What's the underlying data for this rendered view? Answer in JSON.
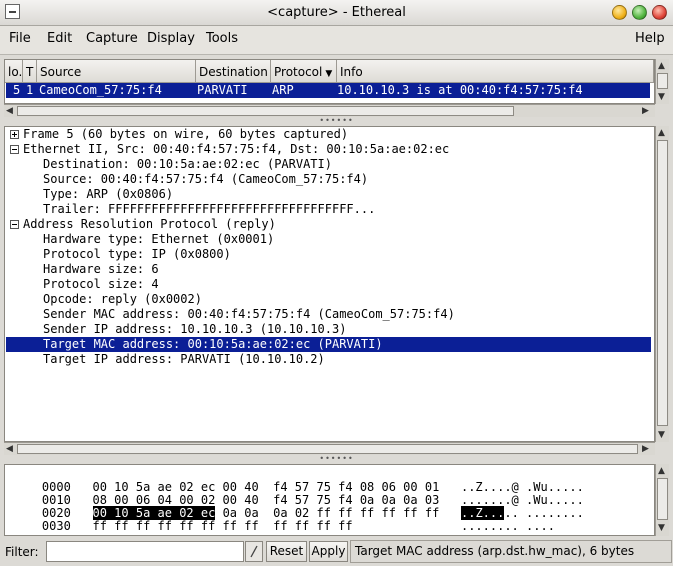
{
  "window": {
    "title": "<capture> - Ethereal"
  },
  "menubar": {
    "file": "File",
    "edit": "Edit",
    "capture": "Capture",
    "display": "Display",
    "tools": "Tools",
    "help": "Help"
  },
  "packet_list": {
    "columns": [
      "lo.",
      "T",
      "Source",
      "Destination",
      "Protocol",
      "Info"
    ],
    "rows": [
      {
        "no": "5",
        "time": "1",
        "source": "CameoCom_57:75:f4",
        "destination": "PARVATI",
        "protocol": "ARP",
        "info": "10.10.10.3 is at 00:40:f4:57:75:f4"
      }
    ]
  },
  "detail_tree": {
    "lines": [
      "Frame 5 (60 bytes on wire, 60 bytes captured)",
      "Ethernet II, Src: 00:40:f4:57:75:f4, Dst: 00:10:5a:ae:02:ec",
      "Destination: 00:10:5a:ae:02:ec (PARVATI)",
      "Source: 00:40:f4:57:75:f4 (CameoCom_57:75:f4)",
      "Type: ARP (0x0806)",
      "Trailer: FFFFFFFFFFFFFFFFFFFFFFFFFFFFFFFFFF...",
      "Address Resolution Protocol (reply)",
      "Hardware type: Ethernet (0x0001)",
      "Protocol type: IP (0x0800)",
      "Hardware size: 6",
      "Protocol size: 4",
      "Opcode: reply (0x0002)",
      "Sender MAC address: 00:40:f4:57:75:f4 (CameoCom_57:75:f4)",
      "Sender IP address: 10.10.10.3 (10.10.10.3)",
      "Target MAC address: 00:10:5a:ae:02:ec (PARVATI)",
      "Target IP address: PARVATI (10.10.10.2)"
    ],
    "selected_index": 14
  },
  "hex_dump": {
    "rows": [
      {
        "offset": "0000",
        "hex_a": "00 10 5a ae 02 ec 00 40",
        "hex_b": "f4 57 75 f4 08 06 00 01",
        "ascii_a": "..Z....@",
        "ascii_b": ".Wu....."
      },
      {
        "offset": "0010",
        "hex_a": "08 00 06 04 00 02 00 40",
        "hex_b": "f4 57 75 f4 0a 0a 0a 03",
        "ascii_a": ".......@",
        "ascii_b": ".Wu....."
      },
      {
        "offset": "0020",
        "hex_sel": "00 10 5a ae 02 ec",
        "hex_a_rest": "0a 0a",
        "hex_b": "0a 02 ff ff ff ff ff ff",
        "ascii_sel": "..Z...",
        "ascii_a_rest": "..",
        "ascii_b": "........"
      },
      {
        "offset": "0030",
        "hex_a": "ff ff ff ff ff ff ff ff",
        "hex_b": "ff ff ff ff",
        "ascii_a": "........",
        "ascii_b": "...."
      }
    ]
  },
  "statusbar": {
    "filter_label": "Filter:",
    "filter_value": "",
    "reset": "Reset",
    "apply": "Apply",
    "status_text": "Target MAC address (arp.dst.hw_mac), 6 bytes"
  },
  "colors": {
    "selection": "#0b1f96",
    "close": "#e0463b",
    "minimize": "#f0b21c",
    "maximize": "#52b540"
  }
}
